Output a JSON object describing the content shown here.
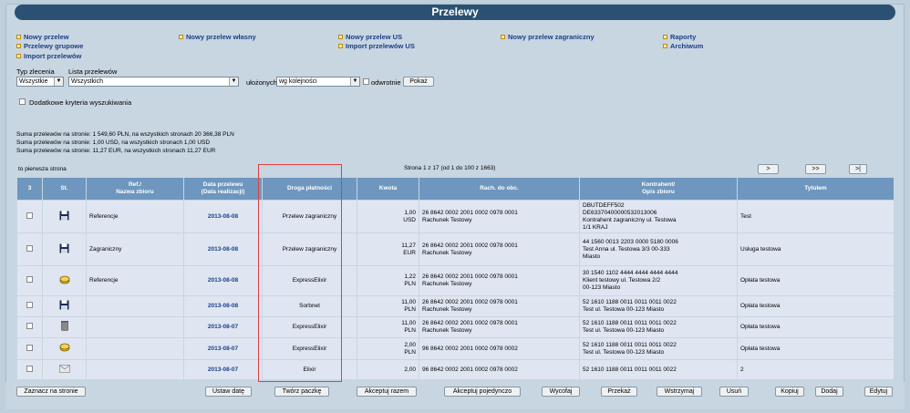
{
  "title": "Przelewy",
  "nav": [
    {
      "label": "Nowy przelew"
    },
    {
      "label": "Przelewy grupowe"
    },
    {
      "label": "Import przelewów"
    },
    {
      "label": "Nowy przelew własny"
    },
    {
      "label": "Nowy przelew US"
    },
    {
      "label": "Import przelewów US"
    },
    {
      "label": "Nowy przelew zagraniczny"
    },
    {
      "label": "Raporty"
    },
    {
      "label": "Archiwum"
    }
  ],
  "filters": {
    "type_label": "Typ zlecenia",
    "type_value": "Wszystkie",
    "list_label": "Lista przelewów",
    "list_value": "Wszystkich",
    "sorted_label": "ułożonych",
    "sorted_value": "wg kolejności",
    "reverse_label": "odwrotnie",
    "show_button": "Pokaż",
    "extra_label": "Dodatkowe kryteria wyszukiwania"
  },
  "summary": [
    "Suma przelewów na stronie: 1 549,60 PLN, na wszystkich stronach 20 366,38 PLN",
    "Suma przelewów na stronie: 1,00 USD, na wszystkich stronach 1,00 USD",
    "Suma przelewów na stronie: 11,27 EUR, na wszystkich stronach 11,27 EUR"
  ],
  "pager": {
    "first_page": "to pierwsza strona",
    "info": "Strona 1 z 17 (od 1 do 100 z 1663)",
    "next": ">",
    "next_many": ">>",
    "last": ">|"
  },
  "table": {
    "headers": [
      "3",
      "St.",
      "Ref./\nNazwa zbioru",
      "Data przelewu\n(Data realizacji)",
      "Droga płatności",
      "Kwota",
      "Rach. do obc.",
      "Kontrahent/\nOpis zbioru",
      "Tytułem"
    ],
    "rows": [
      {
        "icon": "floppy",
        "ref": "Referencje",
        "date": "2013-08-08",
        "route": "Przelew zagraniczny",
        "amount": "1,00",
        "currency": "USD",
        "account": "26 8642 0002 2001 0002 0978 0001",
        "account_name": "Rachunek Testowy",
        "contractor": "DBUTDEFF502\nDE63370400000532013006\nKontrahent zagraniczny ul. Testowa\n1/1 KRAJ",
        "title": "Test"
      },
      {
        "icon": "floppy",
        "ref": "Zagraniczny",
        "date": "2013-08-08",
        "route": "Przelew zagraniczny",
        "amount": "11,27",
        "currency": "EUR",
        "account": "26 8642 0002 2001 0002 0978 0001",
        "account_name": "Rachunek Testowy",
        "contractor": "44 1560 0013 2203 0000 5180 0006\nTest Anna ul. Testowa 3/3 00-333\nMiasto",
        "title": "Usługa testowa"
      },
      {
        "icon": "coins",
        "ref": "Referencje",
        "date": "2013-08-08",
        "route": "ExpressElixir",
        "amount": "1,22",
        "currency": "PLN",
        "account": "26 8642 0002 2001 0002 0978 0001",
        "account_name": "Rachunek Testowy",
        "contractor": "30 1540 1102 4444 4444 4444 4444\nKlient testowy ul. Testowa 2/2\n00-123 Miasto",
        "title": "Opłata testowa"
      },
      {
        "icon": "floppy",
        "ref": "",
        "date": "2013-08-08",
        "route": "Sorbnet",
        "amount": "11,00",
        "currency": "PLN",
        "account": "26 8642 0002 2001 0002 0978 0001",
        "account_name": "Rachunek Testowy",
        "contractor": "52 1610 1188 0011 0011 0011 0022\nTest ul. Testowa 00-123 Miasto",
        "title": "Opłata testowa"
      },
      {
        "icon": "bin",
        "ref": "",
        "date": "2013-08-07",
        "route": "ExpressElixir",
        "amount": "11,00",
        "currency": "PLN",
        "account": "26 8642 0002 2001 0002 0978 0001",
        "account_name": "Rachunek Testowy",
        "contractor": "52 1610 1188 0011 0011 0011 0022\nTest ul. Testowa 00-123 Miasto",
        "title": "Opłata testowa"
      },
      {
        "icon": "coins",
        "ref": "",
        "date": "2013-08-07",
        "route": "ExpressElixir",
        "amount": "2,00",
        "currency": "PLN",
        "account": "96 8642 0002 2001 0002 0978 0002",
        "account_name": "",
        "contractor": "52 1610 1188 0011 0011 0011 0022\nTest ul. Testowa 00-123 Miasto",
        "title": "Opłata testowa"
      },
      {
        "icon": "envelope",
        "ref": "",
        "date": "2013-08-07",
        "route": "Elixir",
        "amount": "2,00",
        "currency": "",
        "account": "96 8642 0002 2001 0002 0978 0002",
        "account_name": "",
        "contractor": "52 1610 1188 0011 0011 0011 0022",
        "title": "2"
      }
    ]
  },
  "buttons": {
    "mark_page": "Zaznacz na stronie",
    "set_date": "Ustaw datę",
    "create_package": "Twórz paczkę",
    "accept_together": "Akceptuj razem",
    "accept_single": "Akceptuj pojedynczo",
    "withdraw": "Wycofaj",
    "transfer": "Przekaż",
    "hold": "Wstrzymaj",
    "delete": "Usuń",
    "copy": "Kopiuj",
    "add": "Dodaj",
    "edit": "Edytuj"
  }
}
